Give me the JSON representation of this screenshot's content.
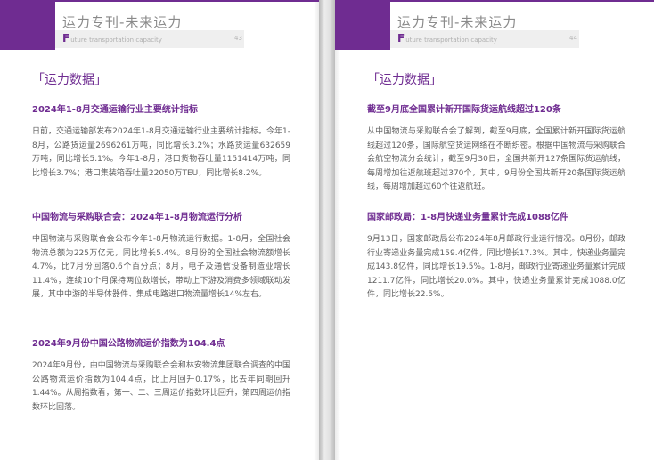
{
  "header_title": "运力专刊-未来运力",
  "header_sub_first": "F",
  "header_sub_rest": "uture transportation capacity",
  "section_tag": "「运力数据」",
  "left_page": {
    "page_number": "43",
    "articles": [
      {
        "heading": "2024年1-8月交通运输行业主要统计指标",
        "body": "日前，交通运输部发布2024年1-8月交通运输行业主要统计指标。今年1-8月，公路货运量2696261万吨，同比增长3.2%；水路货运量632659万吨，同比增长5.1%。今年1-8月，港口货物吞吐量1151414万吨，同比增长3.7%；港口集装箱吞吐量22050万TEU，同比增长8.2%。"
      },
      {
        "heading": "中国物流与采购联合会：2024年1-8月物流运行分析",
        "body": "中国物流与采购联合会公布今年1-8月物流运行数据。1-8月，全国社会物流总额为225万亿元，同比增长5.4%。8月份的全国社会物流额增长4.7%，比7月份回落0.6个百分点；8月，电子及通信设备制造业增长11.4%，连续10个月保持两位数增长，带动上下游及消费多领域联动发展，其中中游的半导体器件、集成电路进口物流量增长14%左右。"
      },
      {
        "heading": "2024年9月份中国公路物流运价指数为104.4点",
        "body": "2024年9月份，由中国物流与采购联合会和林安物流集团联合调查的中国公路物流运价指数为104.4点，比上月回升0.17%，比去年同期回升1.44%。从周指数看，第一、二、三周运价指数环比回升，第四周运价指数环比回落。"
      }
    ]
  },
  "right_page": {
    "page_number": "44",
    "articles": [
      {
        "heading": "截至9月底全国累计新开国际货运航线超过120条",
        "body": "从中国物流与采购联合会了解到，截至9月底，全国累计新开国际货运航线超过120条，国际航空货运网络在不断织密。根据中国物流与采购联合会航空物流分会统计，截至9月30日，全国共新开127条国际货运航线，每周增加往返航班超过370个，其中，9月份全国共新开20条国际货运航线，每周增加超过60个往返航班。"
      },
      {
        "heading": "国家邮政局：1-8月快递业务量累计完成1088亿件",
        "body": "9月13日，国家邮政局公布2024年8月邮政行业运行情况。8月份，邮政行业寄递业务量完成159.4亿件，同比增长17.3%。其中，快递业务量完成143.8亿件，同比增长19.5%。1-8月，邮政行业寄递业务量累计完成1211.7亿件，同比增长20.0%。其中，快递业务量累计完成1088.0亿件，同比增长22.5%。"
      }
    ]
  },
  "colors": {
    "accent": "#6f2c91",
    "body_text": "#5f5f5f",
    "header_text": "#8a8a8a"
  }
}
